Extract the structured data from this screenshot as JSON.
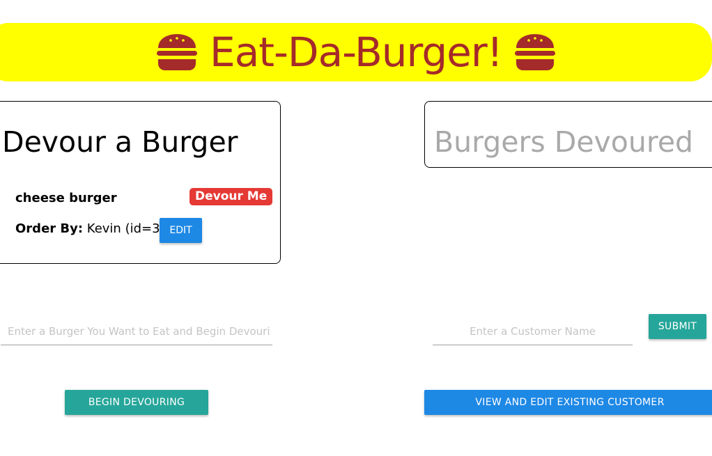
{
  "banner": {
    "title": "Eat-Da-Burger!",
    "icon_left": "hamburger-icon",
    "icon_right": "hamburger-icon",
    "background": "#ffff00",
    "text_color": "#a52a2a"
  },
  "devour_card": {
    "title": "Devour a Burger",
    "burger_name": "cheese burger",
    "devour_button": "Devour Me",
    "order_label": "Order By:",
    "order_value": " Kevin (id=3)",
    "edit_button": "EDIT"
  },
  "devoured_card": {
    "title": "Burgers Devoured"
  },
  "burger_form": {
    "placeholder": "Enter a Burger You Want to Eat and Begin Devouring",
    "value": "",
    "button": "BEGIN DEVOURING"
  },
  "customer_form": {
    "placeholder": "Enter a Customer Name",
    "value": "",
    "submit_button": "SUBMIT",
    "view_button": "VIEW AND EDIT EXISTING CUSTOMER"
  },
  "colors": {
    "teal": "#26a69a",
    "blue": "#1e88e5",
    "red": "#e53935"
  }
}
